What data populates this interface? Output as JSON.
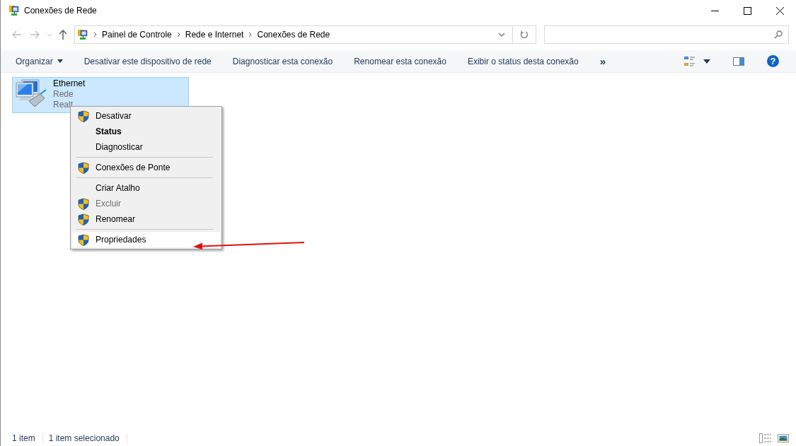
{
  "window": {
    "title": "Conexões de Rede"
  },
  "address_bar": {
    "breadcrumbs": [
      "Painel de Controle",
      "Rede e Internet",
      "Conexões de Rede"
    ]
  },
  "command_bar": {
    "items": [
      {
        "kind": "dropdown",
        "label": "Organizar"
      },
      {
        "kind": "command",
        "label": "Desativar este dispositivo de rede"
      },
      {
        "kind": "command",
        "label": "Diagnosticar esta conexão"
      },
      {
        "kind": "command",
        "label": "Renomear esta conexão"
      },
      {
        "kind": "command",
        "label": "Exibir o status desta conexão"
      },
      {
        "kind": "overflow",
        "label": "»"
      }
    ],
    "help": "?"
  },
  "connections": [
    {
      "name": "Ethernet",
      "status": "Rede",
      "adapter": "Realt",
      "selected": true
    }
  ],
  "context_menu": {
    "items": [
      {
        "kind": "item",
        "label": "Desativar",
        "shield": true,
        "default": false,
        "disabled": false,
        "highlighted": false
      },
      {
        "kind": "item",
        "label": "Status",
        "shield": false,
        "default": true,
        "disabled": false,
        "highlighted": false
      },
      {
        "kind": "item",
        "label": "Diagnosticar",
        "shield": false,
        "default": false,
        "disabled": false,
        "highlighted": false
      },
      {
        "kind": "separator"
      },
      {
        "kind": "item",
        "label": "Conexões de Ponte",
        "shield": true,
        "default": false,
        "disabled": false,
        "highlighted": false
      },
      {
        "kind": "separator"
      },
      {
        "kind": "item",
        "label": "Criar Atalho",
        "shield": false,
        "default": false,
        "disabled": false,
        "highlighted": false
      },
      {
        "kind": "item",
        "label": "Excluir",
        "shield": true,
        "default": false,
        "disabled": true,
        "highlighted": false
      },
      {
        "kind": "item",
        "label": "Renomear",
        "shield": true,
        "default": false,
        "disabled": false,
        "highlighted": false
      },
      {
        "kind": "separator"
      },
      {
        "kind": "item",
        "label": "Propriedades",
        "shield": true,
        "default": false,
        "disabled": false,
        "highlighted": true
      }
    ]
  },
  "status_bar": {
    "item_count": "1 item",
    "selection": "1 item selecionado"
  }
}
